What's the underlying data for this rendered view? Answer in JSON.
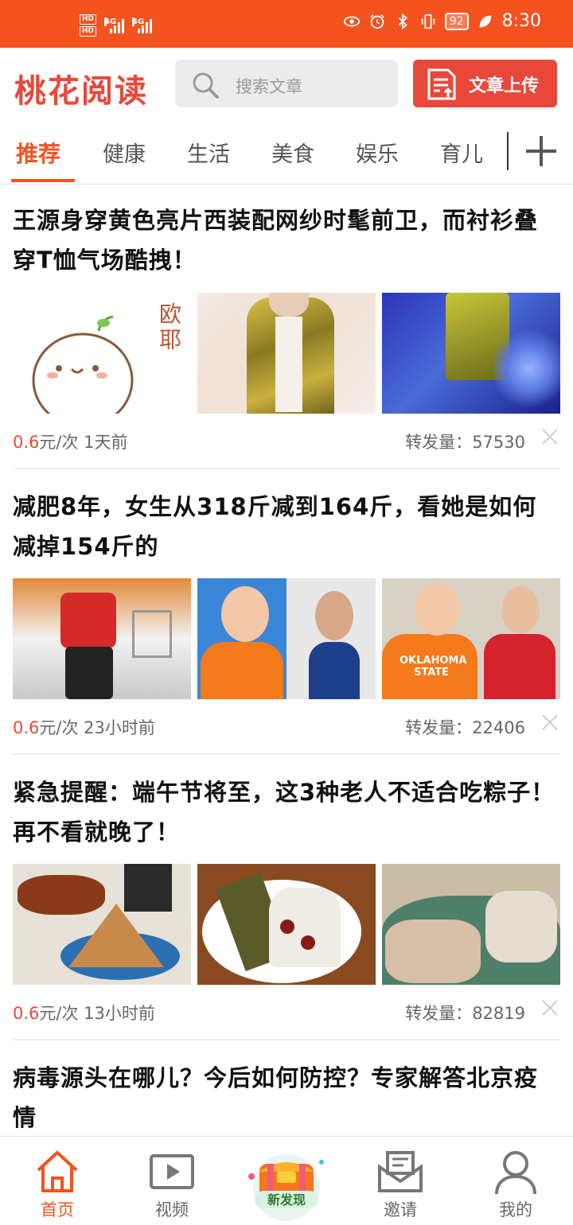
{
  "status_bar": {
    "left_hd": [
      "HD",
      "HD"
    ],
    "network_a": "4G",
    "network_b": "4G",
    "battery": "92",
    "time": "8:30"
  },
  "header": {
    "logo": "桃花阅读",
    "search_placeholder": "搜索文章",
    "upload_label": "文章上传"
  },
  "tabs": [
    "推荐",
    "健康",
    "生活",
    "美食",
    "娱乐",
    "育儿"
  ],
  "active_tab": 0,
  "articles": [
    {
      "title": "王源身穿黄色亮片西装配网纱时髦前卫，而衬衫叠穿T恤气场酷拽！",
      "price": "0.6",
      "unit": "元/次",
      "time": "1天前",
      "forward_label": "转发量：",
      "forward_count": "57530",
      "sticker_text": "欧耶"
    },
    {
      "title": "减肥8年，女生从318斤减到164斤，看她是如何减掉154斤的",
      "price": "0.6",
      "unit": "元/次",
      "time": "23小时前",
      "forward_label": "转发量：",
      "forward_count": "22406",
      "shirt_text": "OKLAHOMA STATE"
    },
    {
      "title": "紧急提醒：端午节将至，这3种老人不适合吃粽子！再不看就晚了！",
      "price": "0.6",
      "unit": "元/次",
      "time": "13小时前",
      "forward_label": "转发量：",
      "forward_count": "82819"
    },
    {
      "title": "病毒源头在哪儿？今后如何防控？专家解答北京疫情"
    }
  ],
  "bottom_nav": {
    "home": "首页",
    "video": "视频",
    "discover": "新发现",
    "invite": "邀请",
    "mine": "我的"
  },
  "colors": {
    "brand": "#f4521e",
    "accent_red": "#e8483a"
  }
}
